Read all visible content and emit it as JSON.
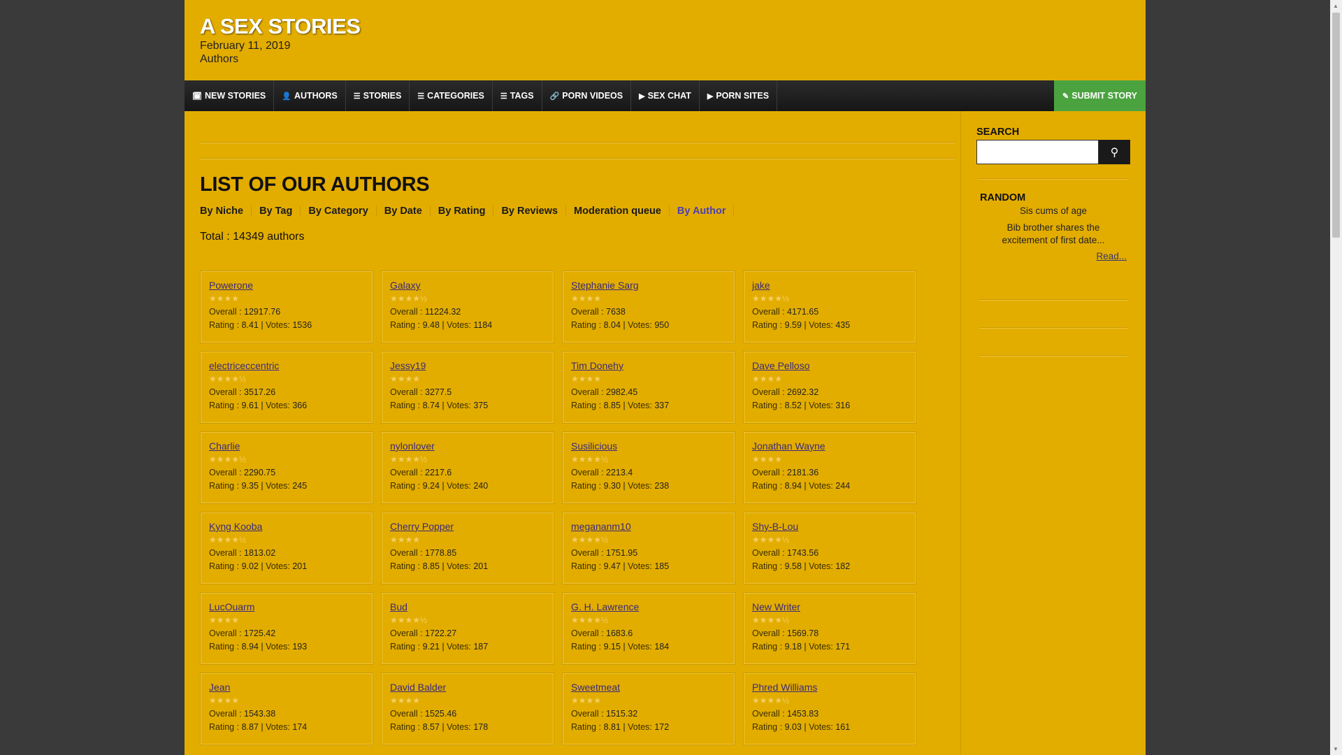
{
  "site": {
    "title": "A SEX STORIES",
    "date": "February 11, 2019",
    "section": "Authors"
  },
  "nav": {
    "items": [
      {
        "label": "NEW STORIES",
        "icon": "calendar-icon",
        "glyph": "🗓"
      },
      {
        "label": "AUTHORS",
        "icon": "user-icon",
        "glyph": "👤"
      },
      {
        "label": "STORIES",
        "icon": "list-icon",
        "glyph": "☰"
      },
      {
        "label": "CATEGORIES",
        "icon": "list-icon",
        "glyph": "☰"
      },
      {
        "label": "TAGS",
        "icon": "list-icon",
        "glyph": "☰"
      },
      {
        "label": "PORN VIDEOS",
        "icon": "link-icon",
        "glyph": "🔗"
      },
      {
        "label": "SEX CHAT",
        "icon": "play-icon",
        "glyph": "▶"
      },
      {
        "label": "PORN SITES",
        "icon": "play-icon",
        "glyph": "▶"
      }
    ],
    "submit": {
      "label": "SUBMIT STORY",
      "icon": "edit-icon",
      "glyph": "✎"
    }
  },
  "main": {
    "title": "LIST OF OUR AUTHORS",
    "filters": [
      "By Niche",
      "By Tag",
      "By Category",
      "By Date",
      "By Rating",
      "By Reviews",
      "Moderation queue",
      "By Author"
    ],
    "active_filter": "By Author",
    "total": "Total : 14349 authors",
    "overall_label": "Overall :",
    "rating_label": "Rating :",
    "votes_label": "Votes:",
    "authors": [
      {
        "name": "Powerone",
        "stars": "★★★★",
        "overall": "12917.76",
        "rating": "8.41",
        "votes": "1536"
      },
      {
        "name": "Galaxy",
        "stars": "★★★★½",
        "overall": "11224.32",
        "rating": "9.48",
        "votes": "1184"
      },
      {
        "name": "Stephanie Sarg",
        "stars": "★★★★",
        "overall": "7638",
        "rating": "8.04",
        "votes": "950"
      },
      {
        "name": "jake",
        "stars": "★★★★½",
        "overall": "4171.65",
        "rating": "9.59",
        "votes": "435"
      },
      {
        "name": "electriceccentric",
        "stars": "★★★★½",
        "overall": "3517.26",
        "rating": "9.61",
        "votes": "366"
      },
      {
        "name": "Jessy19",
        "stars": "★★★★",
        "overall": "3277.5",
        "rating": "8.74",
        "votes": "375"
      },
      {
        "name": "Tim Donehy",
        "stars": "★★★★",
        "overall": "2982.45",
        "rating": "8.85",
        "votes": "337"
      },
      {
        "name": "Dave Pelloso",
        "stars": "★★★★",
        "overall": "2692.32",
        "rating": "8.52",
        "votes": "316"
      },
      {
        "name": "Charlie",
        "stars": "★★★★½",
        "overall": "2290.75",
        "rating": "9.35",
        "votes": "245"
      },
      {
        "name": "nylonlover",
        "stars": "★★★★½",
        "overall": "2217.6",
        "rating": "9.24",
        "votes": "240"
      },
      {
        "name": "Susilicious",
        "stars": "★★★★½",
        "overall": "2213.4",
        "rating": "9.30",
        "votes": "238"
      },
      {
        "name": "Jonathan Wayne",
        "stars": "★★★★",
        "overall": "2181.36",
        "rating": "8.94",
        "votes": "244"
      },
      {
        "name": "Kyng Kooba",
        "stars": "★★★★½",
        "overall": "1813.02",
        "rating": "9.02",
        "votes": "201"
      },
      {
        "name": "Cherry Popper",
        "stars": "★★★★",
        "overall": "1778.85",
        "rating": "8.85",
        "votes": "201"
      },
      {
        "name": "megananm10",
        "stars": "★★★★½",
        "overall": "1751.95",
        "rating": "9.47",
        "votes": "185"
      },
      {
        "name": "Shy-B-Lou",
        "stars": "★★★★½",
        "overall": "1743.56",
        "rating": "9.58",
        "votes": "182"
      },
      {
        "name": "LucOuarm",
        "stars": "★★★★",
        "overall": "1725.42",
        "rating": "8.94",
        "votes": "193"
      },
      {
        "name": "Bud",
        "stars": "★★★★½",
        "overall": "1722.27",
        "rating": "9.21",
        "votes": "187"
      },
      {
        "name": "G. H. Lawrence",
        "stars": "★★★★½",
        "overall": "1683.6",
        "rating": "9.15",
        "votes": "184"
      },
      {
        "name": "New Writer",
        "stars": "★★★★½",
        "overall": "1569.78",
        "rating": "9.18",
        "votes": "171"
      },
      {
        "name": "Jean",
        "stars": "★★★★",
        "overall": "1543.38",
        "rating": "8.87",
        "votes": "174"
      },
      {
        "name": "David Balder",
        "stars": "★★★★",
        "overall": "1525.46",
        "rating": "8.57",
        "votes": "178"
      },
      {
        "name": "Sweetmeat",
        "stars": "★★★★",
        "overall": "1515.32",
        "rating": "8.81",
        "votes": "172"
      },
      {
        "name": "Phred Williams",
        "stars": "★★★★½",
        "overall": "1453.83",
        "rating": "9.03",
        "votes": "161"
      }
    ]
  },
  "sidebar": {
    "search_label": "SEARCH",
    "search_icon": "search-icon",
    "random_label": "RANDOM",
    "random_title": "Sis cums of age",
    "random_text": "Bib brother shares the excitement of first date...",
    "read_more": "Read..."
  }
}
